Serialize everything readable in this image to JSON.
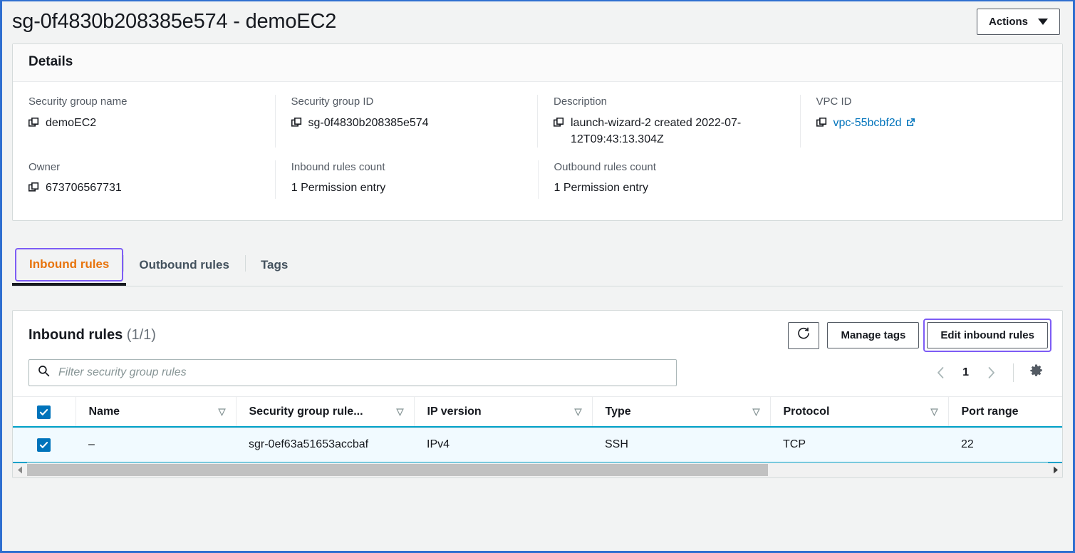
{
  "header": {
    "title": "sg-0f4830b208385e574 - demoEC2",
    "actions_label": "Actions"
  },
  "details": {
    "heading": "Details",
    "row1": [
      {
        "label": "Security group name",
        "value": "demoEC2",
        "copyable": true,
        "link": false
      },
      {
        "label": "Security group ID",
        "value": "sg-0f4830b208385e574",
        "copyable": true,
        "link": false
      },
      {
        "label": "Description",
        "value": "launch-wizard-2 created 2022-07-12T09:43:13.304Z",
        "copyable": true,
        "link": false
      },
      {
        "label": "VPC ID",
        "value": "vpc-55bcbf2d",
        "copyable": true,
        "link": true
      }
    ],
    "row2": [
      {
        "label": "Owner",
        "value": "673706567731",
        "copyable": true,
        "link": false
      },
      {
        "label": "Inbound rules count",
        "value": "1 Permission entry",
        "copyable": false,
        "link": false
      },
      {
        "label": "Outbound rules count",
        "value": "1 Permission entry",
        "copyable": false,
        "link": false
      }
    ]
  },
  "tabs": [
    {
      "label": "Inbound rules",
      "active": true
    },
    {
      "label": "Outbound rules",
      "active": false
    },
    {
      "label": "Tags",
      "active": false
    }
  ],
  "panel": {
    "title": "Inbound rules",
    "count": "(1/1)",
    "refresh_icon": "refresh-icon",
    "manage_tags_label": "Manage tags",
    "edit_rules_label": "Edit inbound rules",
    "search_placeholder": "Filter security group rules",
    "search_value": "",
    "page_number": "1",
    "prev_icon": "chevron-left-icon",
    "next_icon": "chevron-right-icon",
    "settings_icon": "gear-icon"
  },
  "table": {
    "columns": [
      "Name",
      "Security group rule...",
      "IP version",
      "Type",
      "Protocol",
      "Port range"
    ],
    "header_checkbox_checked": true,
    "rows": [
      {
        "checked": true,
        "selected": true,
        "cells": [
          "–",
          "sgr-0ef63a51653accbaf",
          "IPv4",
          "SSH",
          "TCP",
          "22"
        ]
      }
    ]
  },
  "colors": {
    "accent_orange": "#e8740c",
    "link_blue": "#0073bb",
    "focus_purple": "#7d5cf5",
    "checkbox_blue": "#0073bb",
    "selected_row_bg": "#f1faff",
    "selected_row_border": "#00a1c9"
  }
}
